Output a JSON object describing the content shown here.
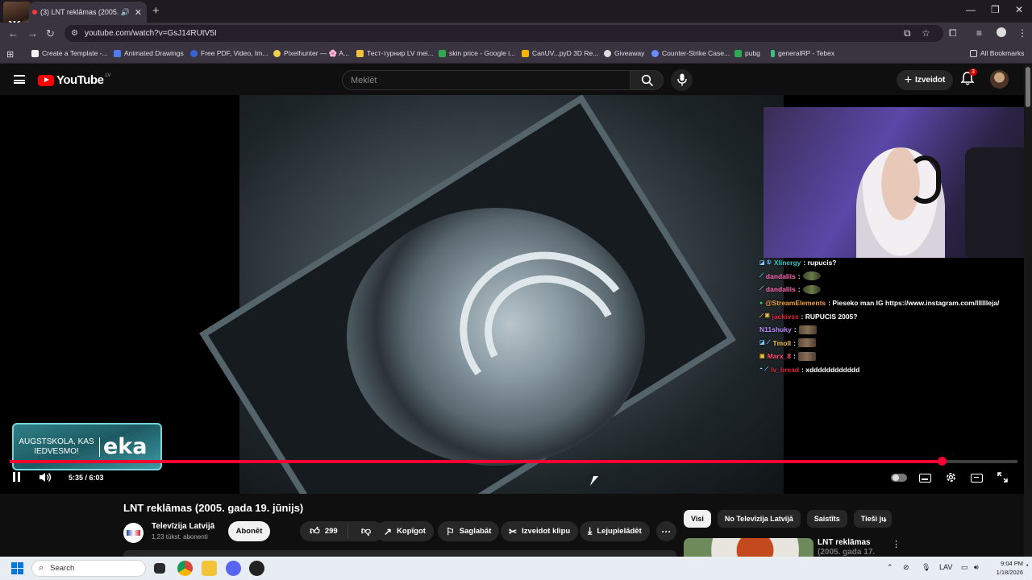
{
  "browser": {
    "tab_title": "(3) LNT reklāmas (2005. gada",
    "tab_close": "✕",
    "new_tab": "+",
    "url": "youtube.com/watch?v=GsJ14RUtV5I",
    "window_controls": [
      "—",
      "❐",
      "✕"
    ],
    "bookmarks": [
      {
        "label": "Create a Template -...",
        "color": "#f2f2f2"
      },
      {
        "label": "Animated Drawings",
        "color": "#4f7df0"
      },
      {
        "label": "Free PDF, Video, Im...",
        "color": "#3a62d8"
      },
      {
        "label": "Pixelhunter — 🌸 A...",
        "color": "#f1d04a"
      },
      {
        "label": "Тест-турнир LV mei...",
        "color": "#f0c23a"
      },
      {
        "label": "skin price - Google i...",
        "color": "#2fa84f"
      },
      {
        "label": "CanUV...pyD 3D Re...",
        "color": "#f4b400"
      },
      {
        "label": "Giveaway",
        "color": "#dcdcdc"
      },
      {
        "label": "Counter-Strike Case...",
        "color": "#6a8cff"
      },
      {
        "label": "pubg",
        "color": "#2fa84f"
      },
      {
        "label": "generalRP - Tebex",
        "color": "#3fbf7f"
      }
    ],
    "all_bookmarks": "All Bookmarks"
  },
  "youtube": {
    "logo_text": "YouTube",
    "logo_region": "LV",
    "search_placeholder": "Meklēt",
    "create_label": "Izveidot",
    "notifications_count": "3"
  },
  "player": {
    "ad_left_text_line1": "AUGSTSKOLA, KAS",
    "ad_left_text_line2": "IEDVESMO!",
    "ad_right_text": "eka",
    "current_time": "5:35",
    "duration": "6:03",
    "time_display": "5:35 / 6:03",
    "progress_fraction": 0.925
  },
  "chat": [
    {
      "badges": "◪ ①",
      "user": "Xlinergy",
      "color": "#35c7c7",
      "msg": "rupucis?",
      "emote": ""
    },
    {
      "badges": "⟋",
      "user": "dandaliis",
      "color": "#ff69b4",
      "msg": "",
      "emote": "frog"
    },
    {
      "badges": "⟋",
      "user": "dandaliis",
      "color": "#ff69b4",
      "msg": "",
      "emote": "frog"
    },
    {
      "badges": "●",
      "user": "@StreamElements",
      "color": "#f3a33a",
      "msg": "Pieseko man IG https://www.instagram.com/lllllleja/",
      "emote": ""
    },
    {
      "badges": "⟋ ▣",
      "user": "jackivss",
      "color": "#e0243b",
      "msg": "RUPUCIS 2005?",
      "emote": ""
    },
    {
      "badges": "",
      "user": "N11shuky",
      "color": "#b98cff",
      "msg": "",
      "emote": "face"
    },
    {
      "badges": "◪ ⟋",
      "user": "Tmoll",
      "color": "#f2c13b",
      "msg": "",
      "emote": "face"
    },
    {
      "badges": "▣",
      "user": "Marx_8",
      "color": "#ff4d6d",
      "msg": "",
      "emote": "face"
    },
    {
      "badges": "◓ ⟋",
      "user": "lv_bread",
      "color": "#e0243b",
      "msg": "xdddddddddddd",
      "emote": ""
    }
  ],
  "video": {
    "title": "LNT reklāmas (2005. gada 19. jūnijs)",
    "channel_name": "Televīzija Latvijā",
    "subscribers": "1,23 tūkst. abonenti",
    "subscribe_label": "Abonēt",
    "likes": "299",
    "share_label": "Kopīgot",
    "save_label": "Saglabāt",
    "clip_label": "Izveidot klipu",
    "download_label": "Lejupielādēt",
    "more_label": "···"
  },
  "sidebar": {
    "chips": [
      "Visi",
      "No Televīzija Latvijā",
      "Saistīts",
      "Tieši ju"
    ],
    "rec_title_line1": "LNT reklāmas",
    "rec_title_line2": "(2005. gada 17."
  },
  "taskbar": {
    "search_placeholder": "Search",
    "language": "LAV",
    "time": "9:04 PM",
    "date": "1/18/2026"
  }
}
